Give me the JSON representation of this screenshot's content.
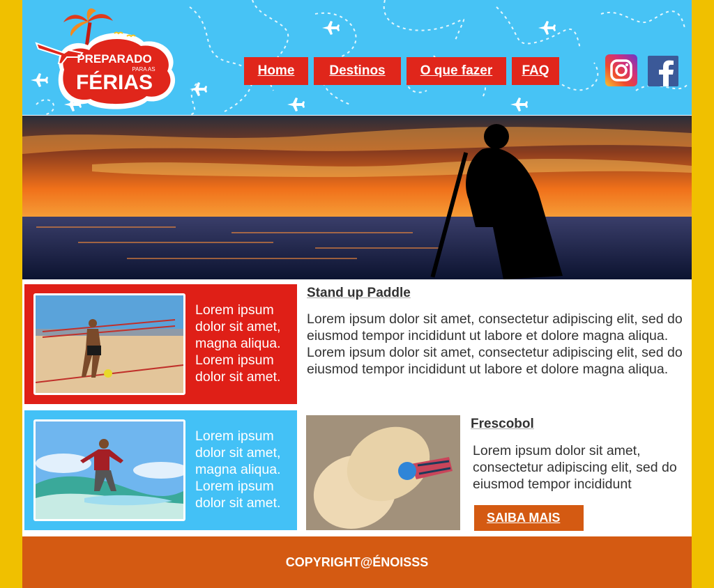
{
  "logo": {
    "line1": "PREPARADO",
    "line2": "PARA AS",
    "line3": "FÉRIAS"
  },
  "nav": [
    {
      "label": "Home"
    },
    {
      "label": "Destinos"
    },
    {
      "label": "O que fazer"
    },
    {
      "label": "FAQ"
    }
  ],
  "social": {
    "instagram": "instagram-icon",
    "facebook": "facebook-icon"
  },
  "cards": [
    {
      "text": "Lorem ipsum dolor sit amet, magna aliqua. Lorem ipsum dolor sit amet.",
      "color": "#df1f17"
    },
    {
      "text": "Lorem ipsum dolor sit amet, magna aliqua. Lorem ipsum dolor sit amet.",
      "color": "#43c1f6"
    }
  ],
  "section1": {
    "title": "Stand up Paddle",
    "body": "Lorem ipsum dolor sit amet, consectetur adipiscing elit, sed do eiusmod tempor incididunt ut labore et dolore magna aliqua. Lorem ipsum dolor sit amet, consectetur adipiscing elit, sed do eiusmod tempor incididunt ut labore et dolore magna aliqua."
  },
  "section2": {
    "title": "Frescobol",
    "body": "Lorem ipsum dolor sit amet, consectetur adipiscing elit, sed do eiusmod tempor incididunt",
    "button": "SAIBA MAIS"
  },
  "footer": {
    "copyright": "COPYRIGHT@ÉNOISSS"
  },
  "colors": {
    "background": "#f0c000",
    "header": "#47c3f5",
    "accent_red": "#e0261b",
    "accent_orange": "#d45a12"
  }
}
